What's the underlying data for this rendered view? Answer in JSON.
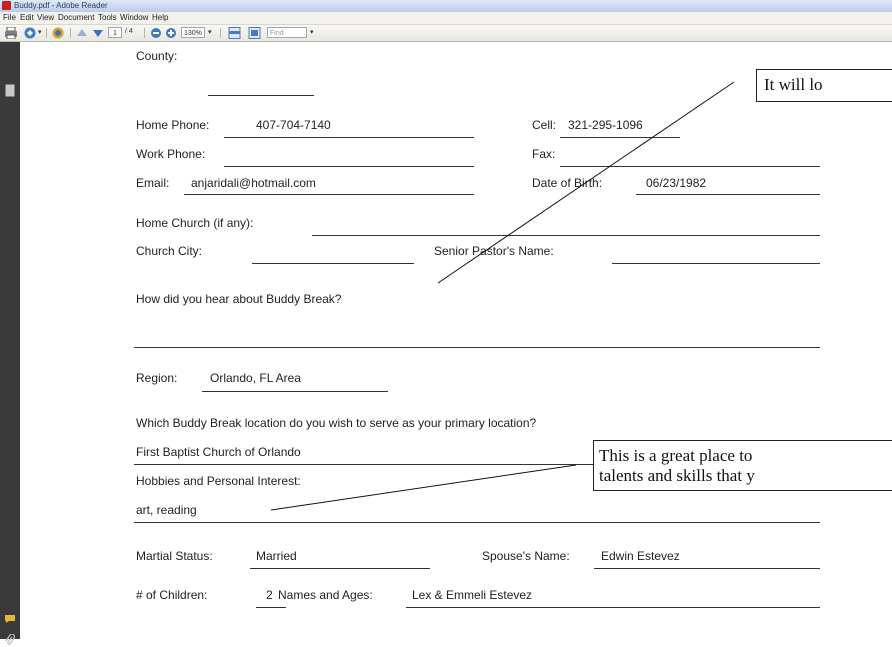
{
  "window": {
    "title": "Buddy.pdf - Adobe Reader"
  },
  "menu": [
    "File",
    "Edit",
    "View",
    "Document",
    "Tools",
    "Window",
    "Help"
  ],
  "toolbar": {
    "page_current": "1",
    "page_total": "/ 4",
    "zoom": "130%",
    "find_placeholder": "Find"
  },
  "form": {
    "county_label": "County:",
    "home_phone_label": "Home Phone:",
    "home_phone": "407-704-7140",
    "cell_label": "Cell:",
    "cell": "321-295-1096",
    "work_phone_label": "Work Phone:",
    "fax_label": "Fax:",
    "email_label": "Email:",
    "email": "anjaridali@hotmail.com",
    "dob_label": "Date of Birth:",
    "dob": "06/23/1982",
    "home_church_label": "Home Church (if any):",
    "church_city_label": "Church City:",
    "pastor_label": "Senior Pastor's Name:",
    "hear_label": "How did you hear about Buddy Break?",
    "region_label": "Region:",
    "region": "Orlando, FL Area",
    "location_question": "Which Buddy Break location do you wish to serve as your primary location?",
    "location": "First Baptist Church of Orlando",
    "hobbies_label": "Hobbies and Personal Interest:",
    "hobbies": "art, reading",
    "marital_label": "Martial Status:",
    "marital": "Married",
    "spouse_label": "Spouse's Name:",
    "spouse": "Edwin Estevez",
    "children_label": "# of Children:",
    "children": "2",
    "names_ages_label": "Names and Ages:",
    "names_ages": "Lex & Emmeli Estevez"
  },
  "callouts": {
    "top": "It will lo",
    "middle_line1": "This is a great place to",
    "middle_line2": "talents and skills that y"
  },
  "icons": [
    "print-icon",
    "email-icon",
    "collaborate-icon",
    "prev-page-icon",
    "next-page-icon",
    "zoom-out-icon",
    "zoom-in-icon",
    "fit-page-icon",
    "fit-width-icon",
    "pages-icon",
    "comments-icon",
    "attachments-icon"
  ]
}
